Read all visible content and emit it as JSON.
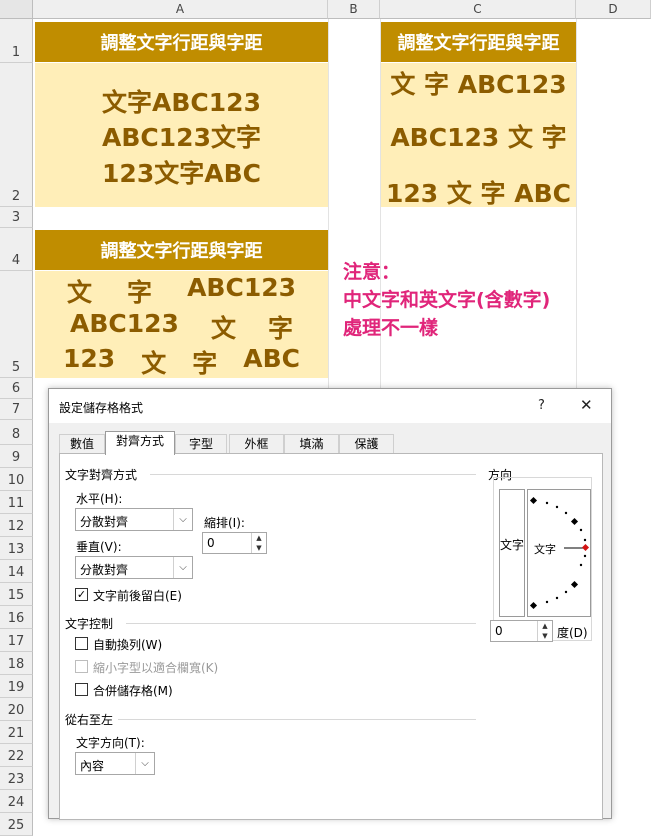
{
  "columns": [
    "A",
    "B",
    "C",
    "D"
  ],
  "rows": [
    "1",
    "2",
    "3",
    "4",
    "5",
    "6",
    "7",
    "8",
    "9",
    "10",
    "11",
    "12",
    "13",
    "14",
    "15",
    "16",
    "17",
    "18",
    "19",
    "20",
    "21",
    "22",
    "23",
    "24",
    "25"
  ],
  "cells": {
    "a1": "調整文字行距與字距",
    "c1": "調整文字行距與字距",
    "a4": "調整文字行距與字距",
    "a2_lines": [
      "文字ABC123",
      "ABC123文字",
      "123文字ABC"
    ],
    "c2_lines": [
      "文 字 ABC123",
      "ABC123 文 字",
      "123 文 字 ABC"
    ],
    "a5_line1": [
      "文",
      "字",
      "ABC123"
    ],
    "a5_line2": [
      "ABC123",
      "文",
      "字"
    ],
    "a5_line3": [
      "123",
      "文",
      "字",
      "ABC"
    ]
  },
  "note": {
    "lines": [
      "注意：",
      "中文字和英文字(含數字)",
      "處理不一樣"
    ],
    "color": "#e0257a"
  },
  "colors": {
    "header_bg": "#c08d00",
    "cell_bg": "#ffeeb8",
    "cell_text": "#8c5c00"
  },
  "dialog": {
    "title": "設定儲存格格式",
    "help_label": "?",
    "close_label": "✕",
    "tabs": [
      "數值",
      "對齊方式",
      "字型",
      "外框",
      "填滿",
      "保護"
    ],
    "active_tab": "對齊方式",
    "text_alignment": {
      "section_label": "文字對齊方式",
      "horizontal_label": "水平(H):",
      "horizontal_value": "分散對齊",
      "indent_label": "縮排(I):",
      "indent_value": "0",
      "vertical_label": "垂直(V):",
      "vertical_value": "分散對齊",
      "justify_distributed_label": "文字前後留白(E)",
      "justify_distributed_checked": "✓"
    },
    "text_control": {
      "section_label": "文字控制",
      "wrap_label": "自動換列(W)",
      "shrink_label": "縮小字型以適合欄寬(K)",
      "merge_label": "合併儲存格(M)"
    },
    "rtl": {
      "section_label": "從右至左",
      "direction_label": "文字方向(T):",
      "direction_value": "內容"
    },
    "orientation": {
      "section_label": "方向",
      "vertical_text": "文字",
      "dial_text": "文字",
      "degrees_value": "0",
      "degrees_label": "度(D)"
    }
  }
}
